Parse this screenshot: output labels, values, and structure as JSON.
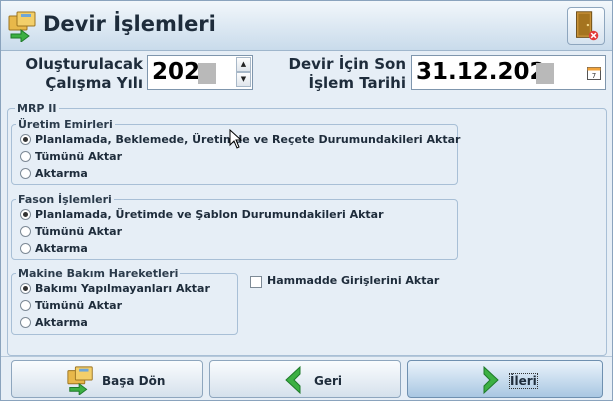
{
  "window": {
    "title": "Devir İşlemleri"
  },
  "header": {
    "year_label_line1": "Oluşturulacak",
    "year_label_line2": "Çalışma Yılı",
    "year_value": "202",
    "date_label_line1": "Devir İçin Son",
    "date_label_line2": "İşlem Tarihi",
    "date_value": "31.12.202"
  },
  "mrp": {
    "title": "MRP II",
    "uretim": {
      "title": "Üretim Emirleri",
      "options": [
        "Planlamada, Beklemede, Üretimde ve Reçete Durumundakileri Aktar",
        "Tümünü Aktar",
        "Aktarma"
      ],
      "selected": 0
    },
    "fason": {
      "title": "Fason İşlemleri",
      "options": [
        "Planlamada, Üretimde ve Şablon Durumundakileri Aktar",
        "Tümünü Aktar",
        "Aktarma"
      ],
      "selected": 0
    },
    "bakim": {
      "title": "Makine Bakım Hareketleri",
      "options": [
        "Bakımı Yapılmayanları Aktar",
        "Tümünü Aktar",
        "Aktarma"
      ],
      "selected": 0
    },
    "hammadde_label": "Hammadde Girişlerini Aktar",
    "hammadde_checked": false
  },
  "footer": {
    "home_label": "Başa Dön",
    "back_label": "Geri",
    "next_label": "İleri"
  },
  "icons": {
    "title": "folders-transfer-icon",
    "exit": "exit-door-icon",
    "calendar": "calendar-icon",
    "back": "arrow-left-icon",
    "next": "arrow-right-icon"
  },
  "colors": {
    "background": "#e6eef6",
    "arrow": "#3cb043",
    "border": "#a8bfd6"
  }
}
